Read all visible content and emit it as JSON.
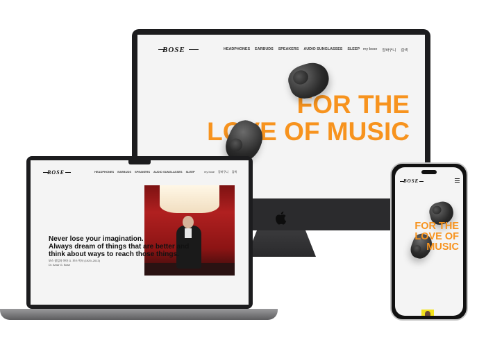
{
  "brand": {
    "logo": "BOSE"
  },
  "nav": {
    "items": [
      "HEADPHONES",
      "EARBUDS",
      "SPEAKERS",
      "AUDIO SUNGLASSES",
      "SLEEP"
    ],
    "utility": [
      "my bose",
      "장바구니",
      "검색"
    ]
  },
  "hero": {
    "line1": "FOR THE",
    "line2": "LOVE OF MUSIC",
    "phone_line1": "FOR THE",
    "phone_line2": "LOVE OF",
    "phone_line3": "MUSIC"
  },
  "laptop": {
    "quote_line1": "Never lose your imagination.",
    "quote_line2": "Always dream of things that are better and",
    "quote_line3": "think about ways to reach those things.",
    "sub_line1": "보스 창업자 아마 G. 보스 박사 (1929–2013)",
    "sub_line2": "Dr. Amar G. Bose"
  },
  "colors": {
    "accent": "#f7931e",
    "screen_bg": "#f4f4f4",
    "device_frame": "#1c1c1e"
  }
}
